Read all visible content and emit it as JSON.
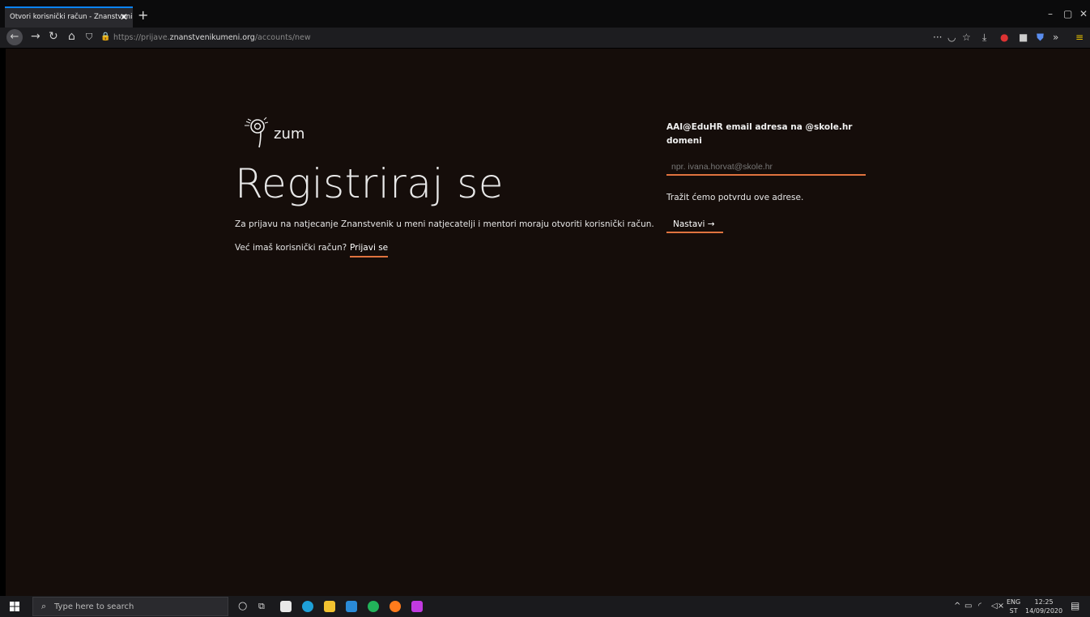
{
  "browser": {
    "tab_title": "Otvori korisnički račun - Znanstveni",
    "tab_close": "✕",
    "new_tab": "+",
    "url_prefix": "https://prijave.",
    "url_domain": "znanstvenikumeni.org",
    "url_path": "/accounts/new"
  },
  "page": {
    "logo_text": "zum",
    "heading": "Registriraj se",
    "intro": "Za prijavu na natjecanje Znanstvenik u meni natjecatelji i mentori moraju otvoriti korisnički račun.",
    "have_account": "Već imaš korisnički račun?",
    "login_link": "Prijavi se",
    "email_label": "AAI@EduHR email adresa na @skole.hr domeni",
    "email_placeholder": "npr. ivana.horvat@skole.hr",
    "email_value": "",
    "note": "Tražit ćemo potvrdu ove adrese.",
    "continue_label": "Nastavi →"
  },
  "taskbar": {
    "search_placeholder": "Type here to search",
    "lang_line1": "ENG",
    "lang_line2": "ST",
    "time": "12:25",
    "date": "14/09/2020"
  },
  "colors": {
    "accent": "#e0733f",
    "page_bg": "#150d0a"
  }
}
